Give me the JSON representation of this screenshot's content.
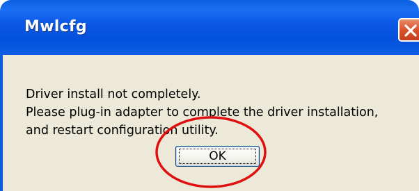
{
  "window": {
    "title": "Mwlcfg",
    "close_icon": "close-icon"
  },
  "message": {
    "lines": [
      "Driver install not completely.",
      "Please plug-in adapter to complete the driver installation,",
      "and restart configuration utility."
    ]
  },
  "buttons": {
    "ok_label": "OK"
  },
  "colors": {
    "titlebar": "#0a5fe0",
    "client_bg": "#ece9d8",
    "close_button": "#d9542a",
    "annotation_circle": "#e01010"
  }
}
